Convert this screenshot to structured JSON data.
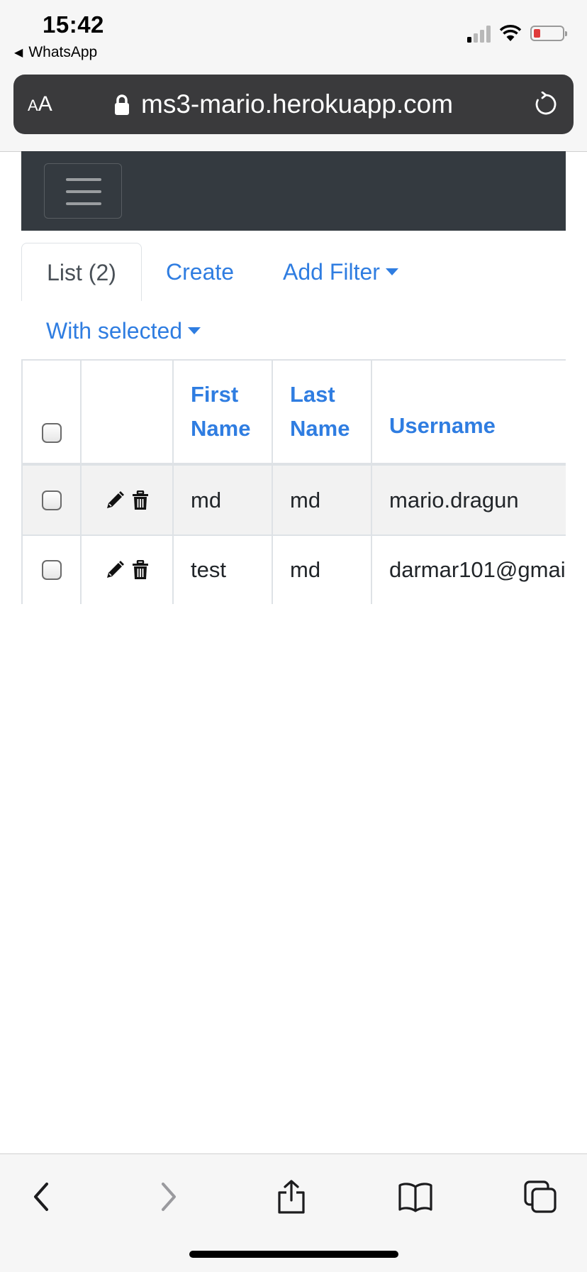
{
  "status_bar": {
    "time": "15:42",
    "back_app": "WhatsApp",
    "icons": [
      "signal-icon",
      "wifi-icon",
      "battery-low-icon"
    ],
    "battery_color": "#e03a3a"
  },
  "address_bar": {
    "text_size_label_small": "A",
    "text_size_label_big": "A",
    "url": "ms3-mario.herokuapp.com",
    "icons": [
      "lock-icon",
      "reload-icon"
    ]
  },
  "navbar": {
    "background": "#343a40",
    "icons": [
      "hamburger-menu-icon"
    ]
  },
  "tabs": [
    {
      "label": "List (2)",
      "active": true
    },
    {
      "label": "Create",
      "active": false
    },
    {
      "label": "Add Filter",
      "active": false,
      "dropdown": true
    }
  ],
  "with_selected": {
    "label": "With selected"
  },
  "table": {
    "headers": [
      "",
      "",
      "First Name",
      "Last Name",
      "Username"
    ],
    "header_lines": {
      "first_name": [
        "First",
        "Name"
      ],
      "last_name": [
        "Last",
        "Name"
      ],
      "username": "Username"
    },
    "rows": [
      {
        "first_name": "md",
        "last_name": "md",
        "username": "mario.dragun"
      },
      {
        "first_name": "test",
        "last_name": "md",
        "username": "darmar101@gmai"
      }
    ],
    "row_icons": [
      "pencil-icon",
      "trash-icon"
    ],
    "header_color": "#2f7de1"
  },
  "toolbar": {
    "icons": [
      "back-chevron-icon",
      "forward-chevron-icon",
      "share-icon",
      "bookmarks-icon",
      "tabs-icon"
    ]
  },
  "accent_color": "#2f7de1"
}
